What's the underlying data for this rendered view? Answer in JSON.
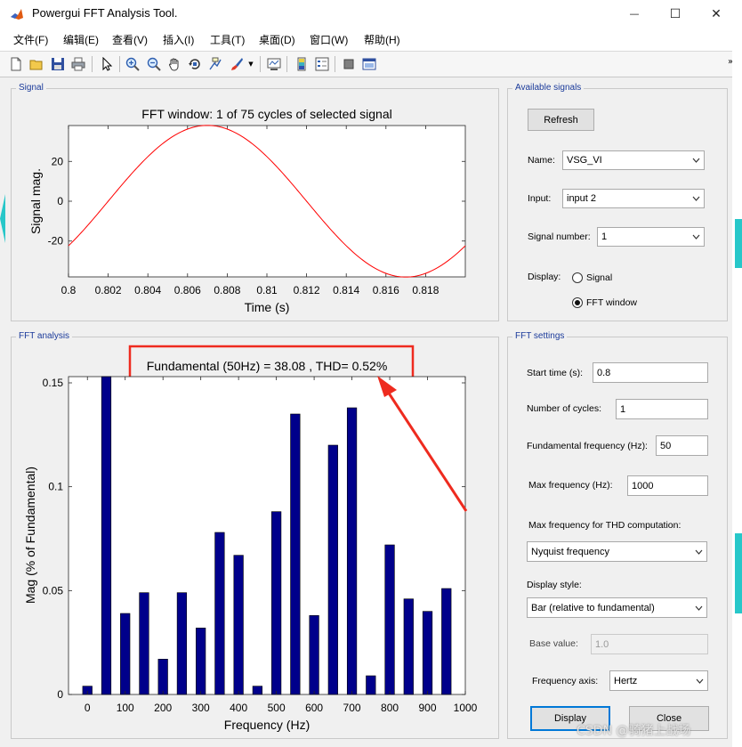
{
  "window": {
    "title": "Powergui FFT Analysis Tool.",
    "buttons": {
      "minimize": "—",
      "maximize": "☐",
      "close": "✕"
    }
  },
  "menu": [
    "文件(F)",
    "编辑(E)",
    "查看(V)",
    "插入(I)",
    "工具(T)",
    "桌面(D)",
    "窗口(W)",
    "帮助(H)"
  ],
  "signal_panel": {
    "title": "Signal"
  },
  "fft_panel": {
    "title": "FFT analysis"
  },
  "available_signals": {
    "title": "Available signals",
    "refresh_label": "Refresh",
    "name_label": "Name:",
    "name_value": "VSG_VI",
    "input_label": "Input:",
    "input_value": "input 2",
    "signal_number_label": "Signal number:",
    "signal_number_value": "1",
    "display_label": "Display:",
    "display_options": [
      "Signal",
      "FFT window"
    ],
    "display_selected": "FFT window"
  },
  "fft_settings": {
    "title": "FFT settings",
    "start_time_label": "Start time (s):",
    "start_time_value": "0.8",
    "cycles_label": "Number of cycles:",
    "cycles_value": "1",
    "fund_freq_label": "Fundamental frequency (Hz):",
    "fund_freq_value": "50",
    "max_freq_label": "Max frequency (Hz):",
    "max_freq_value": "1000",
    "thd_label": "Max frequency for THD computation:",
    "thd_value": "Nyquist frequency",
    "display_style_label": "Display style:",
    "display_style_value": "Bar (relative to fundamental)",
    "base_value_label": "Base value:",
    "base_value_value": "1.0",
    "freq_axis_label": "Frequency axis:",
    "freq_axis_value": "Hertz",
    "display_button": "Display",
    "close_button": "Close"
  },
  "watermark": "CSDN @骑猪上战场",
  "colors": {
    "signal_line": "#ff0000",
    "bar_fill": "#00008b",
    "annotation": "#ee2b1f",
    "panel_title": "#1a3a9a"
  },
  "chart_data": [
    {
      "type": "line",
      "title": "FFT window: 1 of 75 cycles of selected signal",
      "xlabel": "Time (s)",
      "ylabel": "Signal mag.",
      "xlim": [
        0.8,
        0.82
      ],
      "ylim": [
        -38,
        38
      ],
      "xticks": [
        0.8,
        0.802,
        0.804,
        0.806,
        0.808,
        0.81,
        0.812,
        0.814,
        0.816,
        0.818
      ],
      "xtick_labels": [
        "0.8",
        "0.802",
        "0.804",
        "0.806",
        "0.808",
        "0.81",
        "0.812",
        "0.814",
        "0.816",
        "0.818"
      ],
      "yticks": [
        -20,
        0,
        20
      ],
      "ytick_labels": [
        "-20",
        "0",
        "20"
      ],
      "series": [
        {
          "amplitude": 38.08,
          "frequency_hz": 50,
          "peak_time": 0.807
        }
      ]
    },
    {
      "type": "bar",
      "title": "Fundamental (50Hz) = 38.08 , THD= 0.52%",
      "xlabel": "Frequency (Hz)",
      "ylabel": "Mag (% of Fundamental)",
      "xlim": [
        -50,
        1000
      ],
      "ylim": [
        0,
        0.153
      ],
      "xticks": [
        0,
        100,
        200,
        300,
        400,
        500,
        600,
        700,
        800,
        900,
        1000
      ],
      "xtick_labels": [
        "0",
        "100",
        "200",
        "300",
        "400",
        "500",
        "600",
        "700",
        "800",
        "900",
        "1000"
      ],
      "yticks": [
        0,
        0.05,
        0.1,
        0.15
      ],
      "ytick_labels": [
        "0",
        "0.05",
        "0.1",
        "0.15"
      ],
      "x": [
        0,
        50,
        100,
        150,
        200,
        250,
        300,
        350,
        400,
        450,
        500,
        550,
        600,
        650,
        700,
        750,
        800,
        850,
        900,
        950
      ],
      "values": [
        0.004,
        0.16,
        0.039,
        0.049,
        0.017,
        0.049,
        0.032,
        0.078,
        0.067,
        0.004,
        0.088,
        0.135,
        0.038,
        0.12,
        0.138,
        0.009,
        0.072,
        0.046,
        0.04,
        0.051
      ]
    }
  ]
}
